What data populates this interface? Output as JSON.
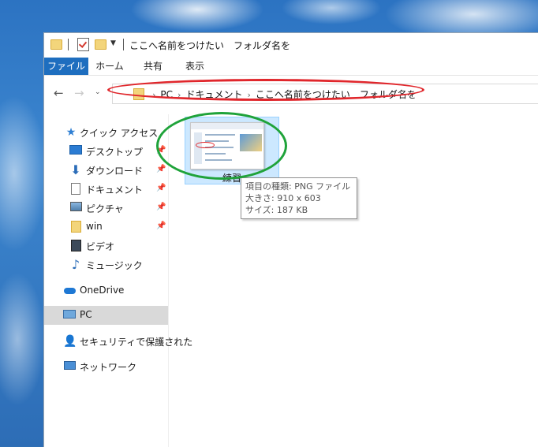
{
  "window": {
    "title": "ここへ名前をつけたい　フォルダ名を"
  },
  "ribbon": {
    "tabs": [
      "ファイル",
      "ホーム",
      "共有",
      "表示"
    ]
  },
  "address": {
    "crumbs": [
      "PC",
      "ドキュメント",
      "ここへ名前をつけたい　フォルダ名を"
    ]
  },
  "sidebar": {
    "items": [
      {
        "label": "クイック アクセス",
        "icon": "star-icon",
        "pinned": false
      },
      {
        "label": "デスクトップ",
        "icon": "desktop-icon",
        "pinned": true
      },
      {
        "label": "ダウンロード",
        "icon": "download-icon",
        "pinned": true
      },
      {
        "label": "ドキュメント",
        "icon": "document-icon",
        "pinned": true
      },
      {
        "label": "ピクチャ",
        "icon": "pictures-icon",
        "pinned": true
      },
      {
        "label": "win",
        "icon": "folder-icon",
        "pinned": true
      },
      {
        "label": "ビデオ",
        "icon": "video-icon",
        "pinned": false
      },
      {
        "label": "ミュージック",
        "icon": "music-icon",
        "pinned": false
      },
      {
        "label": "OneDrive",
        "icon": "cloud-icon",
        "pinned": false
      },
      {
        "label": "PC",
        "icon": "pc-icon",
        "pinned": false,
        "selected": true
      },
      {
        "label": "セキュリティで保護された",
        "icon": "network-secure-icon",
        "pinned": false
      },
      {
        "label": "ネットワーク",
        "icon": "network-icon",
        "pinned": false
      }
    ]
  },
  "file": {
    "name": "練習"
  },
  "tooltip": {
    "type": "項目の種類: PNG ファイル",
    "size_dims": "大きさ: 910 x 603",
    "file_size": "サイズ: 187 KB"
  },
  "annotations": {
    "red_color": "#e0262b",
    "green_color": "#1fa33a"
  }
}
